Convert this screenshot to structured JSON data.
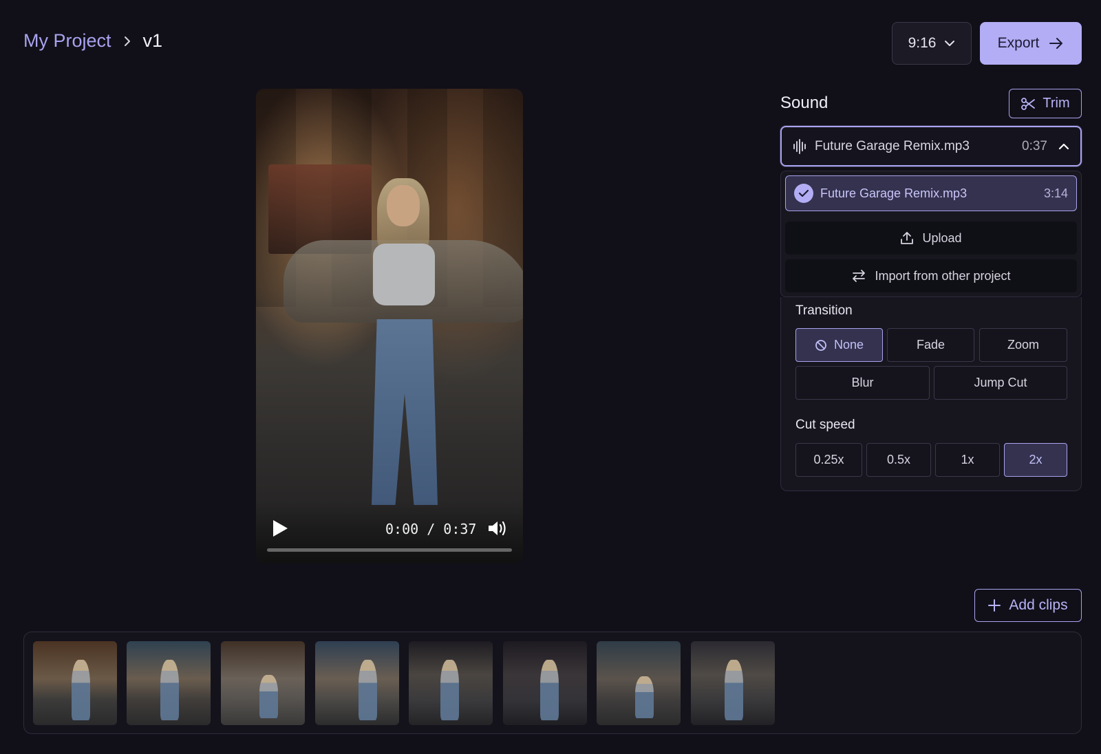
{
  "header": {
    "project": "My Project",
    "version": "v1",
    "aspect_ratio": "9:16",
    "export_label": "Export"
  },
  "player": {
    "time": "0:00 / 0:37",
    "progress": 0
  },
  "sound": {
    "title": "Sound",
    "trim_label": "Trim",
    "selected_file": "Future Garage Remix.mp3",
    "selected_duration": "0:37",
    "dropdown": {
      "option_name": "Future Garage Remix.mp3",
      "option_duration": "3:14",
      "upload_label": "Upload",
      "import_label": "Import from other project"
    }
  },
  "transition": {
    "label": "Transition",
    "options": [
      "None",
      "Fade",
      "Zoom",
      "Blur",
      "Jump Cut"
    ],
    "selected": "None"
  },
  "cut_speed": {
    "label": "Cut speed",
    "options": [
      "0.25x",
      "0.5x",
      "1x",
      "2x"
    ],
    "selected": "2x"
  },
  "clips": {
    "add_label": "Add clips",
    "count": 8
  },
  "colors": {
    "accent": "#a9a3ee",
    "accent_fill": "#b3adf5",
    "background": "#111019"
  },
  "icons": {
    "breadcrumb_separator": "chevron-right-icon",
    "ratio": "chevron-down-icon",
    "export": "arrow-right-icon",
    "trim": "scissors-icon",
    "sound": "audio-wave-icon",
    "dropdown": "chevron-up-icon",
    "selected": "check-icon",
    "upload": "upload-icon",
    "import": "swap-icon",
    "none": "ban-icon",
    "add": "plus-icon",
    "play": "play-icon",
    "volume": "volume-icon"
  }
}
